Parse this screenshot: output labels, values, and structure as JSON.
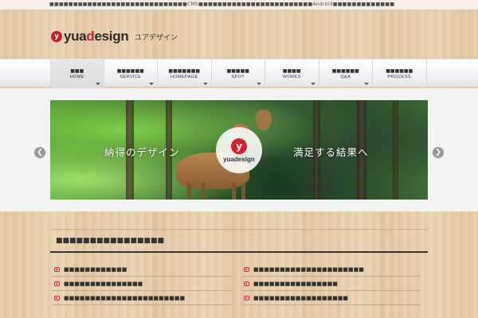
{
  "topbar": {
    "text": "■■■■■■■■■■■■■■■■■■■■■■■■■■■■■CMS■■■■■■■■■■■■■■■■■■■■■■■■Android■■■■■■■■■■■■■"
  },
  "header": {
    "logo_prefix": "yua",
    "logo_accent": "d",
    "logo_suffix": "esign",
    "logo_mark": "y",
    "site_subtitle": "ユアデザイン"
  },
  "nav": {
    "items": [
      {
        "jp": "■■■",
        "en": "HOME",
        "active": true,
        "caret": true
      },
      {
        "jp": "■■■■■■",
        "en": "SERVICE",
        "active": false,
        "caret": true
      },
      {
        "jp": "■■■■■■■",
        "en": "HOMEPAGE",
        "active": false,
        "caret": true
      },
      {
        "jp": "■■■■■",
        "en": "SPOT",
        "active": false,
        "caret": true
      },
      {
        "jp": "■■■■",
        "en": "WORKS",
        "active": false,
        "caret": true
      },
      {
        "jp": "■■■■■■",
        "en": "Q&A",
        "active": false,
        "caret": true
      },
      {
        "jp": "■■■■■■",
        "en": "PROCESS",
        "active": false,
        "caret": false
      }
    ]
  },
  "slider": {
    "text_left": "納得のデザイン",
    "text_right": "満足する結果へ",
    "logo_text": "yuadesign",
    "logo_mark": "y",
    "prev_icon": "chevron-left-icon",
    "next_icon": "chevron-right-icon",
    "prev_glyph": "❮",
    "next_glyph": "❯"
  },
  "section": {
    "title": "■■■■■■■■■■■■■■■■"
  },
  "news_left": [
    "■■■■■■■■■■■■",
    "■■■■■■■■■■■■■■■",
    "■■■■■■■■■■■■■■■■■■■■■■■"
  ],
  "news_right": [
    "■■■■■■■■■■■■■■■■■■■■■",
    "■■■■■■■■■■■■■■■■",
    "■■■■■■■■■■■■■■■■■■"
  ],
  "colors": {
    "brand_red": "#c8202b",
    "wood_bg": "#e6cfaa",
    "divider": "#d9a27f"
  }
}
